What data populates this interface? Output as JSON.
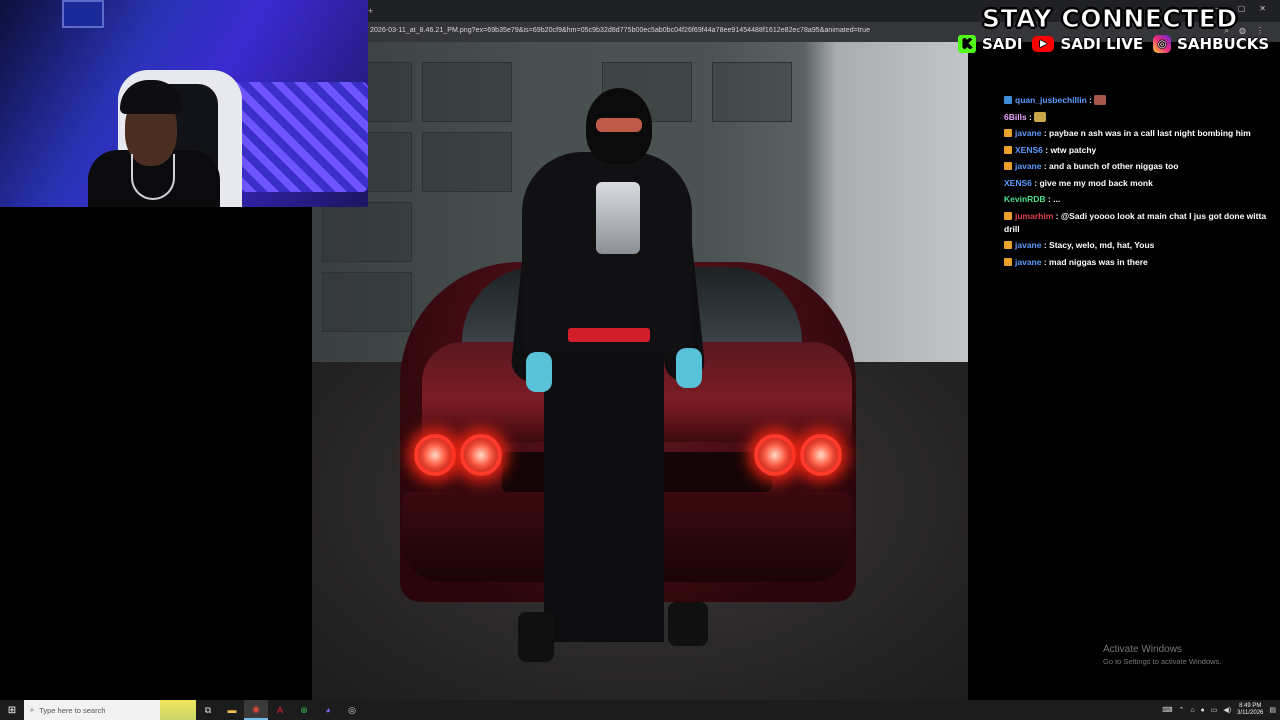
{
  "browser": {
    "url": "2026-03-11_at_8.46.21_PM.png?ex=69b35e79&is=69b20cf9&hm=05c9b32d8d775b00ec5ab0bc04f26f69f44a78ee91454488f1612e82ec78a95&animated=true",
    "new_tab_glyph": "+",
    "window_controls": [
      "—",
      "▢",
      "✕"
    ]
  },
  "overlay": {
    "title": "STAY CONNECTED",
    "socials": [
      {
        "platform": "kick",
        "icon": "kick-icon",
        "glyph": "K",
        "label": "SADI"
      },
      {
        "platform": "youtube",
        "icon": "youtube-icon",
        "glyph": "▶",
        "label": "SADI LIVE"
      },
      {
        "platform": "instagram",
        "icon": "instagram-icon",
        "glyph": "◎",
        "label": "SAHBUCKS"
      }
    ]
  },
  "chat": {
    "messages": [
      {
        "user": "quan_jusbechillin",
        "color": "#5b9bff",
        "badge_color": "#3a8fd8",
        "text": "",
        "emote": "emote"
      },
      {
        "user": "6Bills",
        "color": "#e9a6ff",
        "badge_color": "",
        "text": "",
        "emote": "emote"
      },
      {
        "user": "javane",
        "color": "#5b9bff",
        "badge_color": "#e9a12a",
        "text": "paybae n ash was in a call last night bombing him"
      },
      {
        "user": "XENS6",
        "color": "#5b9bff",
        "badge_color": "#e9a12a",
        "text": "wtw patchy"
      },
      {
        "user": "javane",
        "color": "#5b9bff",
        "badge_color": "#e9a12a",
        "text": "and a bunch of other niggas too"
      },
      {
        "user": "XENS6",
        "color": "#5b9bff",
        "badge_color": "",
        "text": "give me my mod back monk"
      },
      {
        "user": "KevinRDB",
        "color": "#4ddf8b",
        "badge_color": "",
        "text": "..."
      },
      {
        "user": "jumarhim",
        "color": "#e0424b",
        "badge_color": "#e9a12a",
        "text": "@Sadi yoooo look at main chat I jus got done witta drill"
      },
      {
        "user": "javane",
        "color": "#5b9bff",
        "badge_color": "#e9a12a",
        "text": "Stacy, welo, md, hat, Yous"
      },
      {
        "user": "javane",
        "color": "#5b9bff",
        "badge_color": "#e9a12a",
        "text": "mad niggas was in there"
      }
    ]
  },
  "watermark": {
    "title": "Activate Windows",
    "subtitle": "Go to Settings to activate Windows."
  },
  "taskbar": {
    "search_placeholder": "Type here to search",
    "apps": [
      {
        "name": "task-view-icon",
        "glyph": "⧉"
      },
      {
        "name": "file-explorer-icon",
        "glyph": "▬",
        "color": "#f2c14e"
      },
      {
        "name": "chrome-icon",
        "glyph": "◉",
        "color": "#e5483c",
        "active": true
      },
      {
        "name": "acrobat-icon",
        "glyph": "A",
        "color": "#e0232f"
      },
      {
        "name": "xbox-icon",
        "glyph": "⊗",
        "color": "#3ab54a"
      },
      {
        "name": "discord-icon",
        "glyph": "◕",
        "color": "#8a63f5"
      },
      {
        "name": "obs-icon",
        "glyph": "◎",
        "color": "#dddddd"
      }
    ],
    "time": "8:49 PM",
    "date": "3/11/2026"
  }
}
